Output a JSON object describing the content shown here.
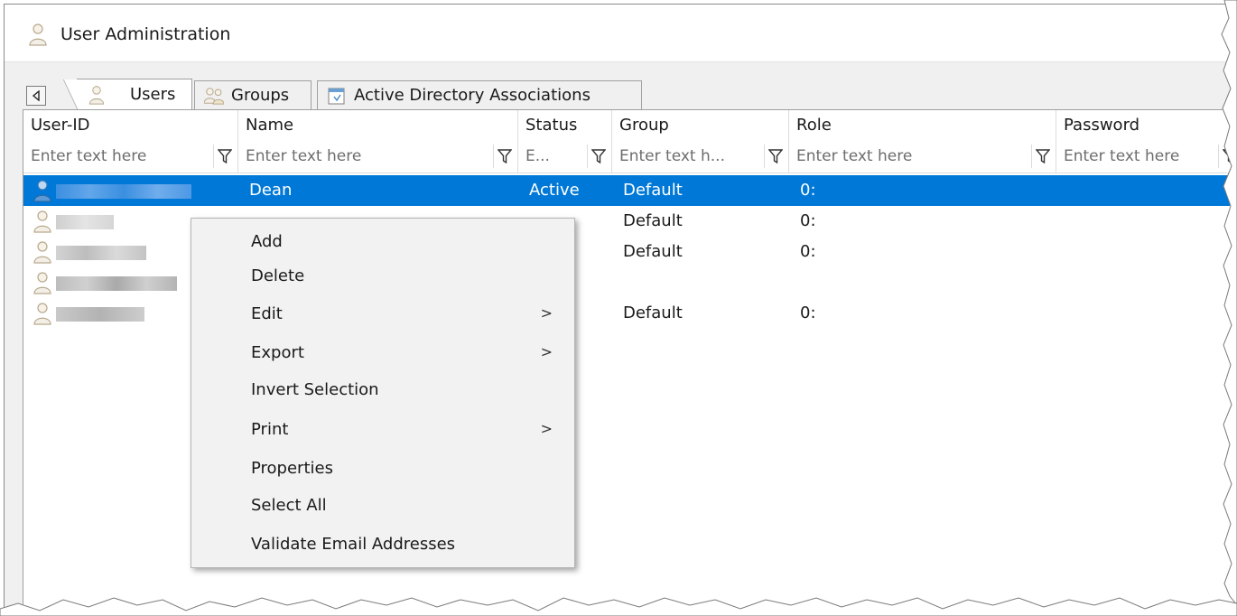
{
  "window": {
    "title": "User Administration"
  },
  "tabs": [
    {
      "label": "Users",
      "active": true
    },
    {
      "label": "Groups",
      "active": false
    },
    {
      "label": "Active Directory Associations",
      "active": false
    }
  ],
  "columns": [
    {
      "header": "User-ID",
      "filter_placeholder": "Enter text here"
    },
    {
      "header": "Name",
      "filter_placeholder": "Enter text here"
    },
    {
      "header": "Status",
      "filter_placeholder": "E..."
    },
    {
      "header": "Group",
      "filter_placeholder": "Enter text h..."
    },
    {
      "header": "Role",
      "filter_placeholder": "Enter text here"
    },
    {
      "header": "Password",
      "filter_placeholder": "Enter text here"
    }
  ],
  "rows": [
    {
      "name": "Dean",
      "status": "Active",
      "group": "Default",
      "role": "0:",
      "selected": true
    },
    {
      "name": "",
      "status": "",
      "group": "Default",
      "role": "0:",
      "selected": false
    },
    {
      "name": "",
      "status": "",
      "group": "Default",
      "role": "0:",
      "selected": false
    },
    {
      "name": "",
      "status": "",
      "group": "",
      "role": "",
      "selected": false
    },
    {
      "name": "",
      "status": "",
      "group": "Default",
      "role": "0:",
      "selected": false
    }
  ],
  "context_menu": {
    "items": [
      {
        "label": "Add",
        "submenu": false
      },
      {
        "label": "Delete",
        "submenu": false
      },
      {
        "label": "Edit",
        "submenu": true
      },
      {
        "label": "Export",
        "submenu": true
      },
      {
        "label": "Invert Selection",
        "submenu": false
      },
      {
        "label": "Print",
        "submenu": true
      },
      {
        "label": "Properties",
        "submenu": false
      },
      {
        "label": "Select All",
        "submenu": false
      },
      {
        "label": "Validate Email Addresses",
        "submenu": false
      }
    ],
    "submenu_arrow": ">"
  },
  "icons": {
    "window": "user-icon",
    "tab_scroll": "triangle-left-icon",
    "filter": "funnel-icon"
  },
  "colors": {
    "selection": "#0078d7",
    "tab_strip": "#f0f0f0",
    "menu_background": "#f2f2f2"
  }
}
